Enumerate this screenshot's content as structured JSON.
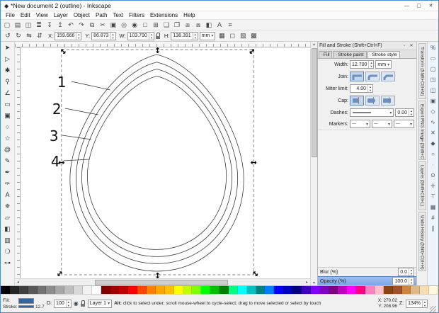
{
  "window": {
    "title": "*New document 2 (outline) - Inkscape",
    "icon": "◆",
    "controls": [
      {
        "name": "minimize-button",
        "glyph": "—"
      },
      {
        "name": "maximize-button",
        "glyph": "▢"
      },
      {
        "name": "close-button",
        "glyph": "✕"
      }
    ]
  },
  "menu": {
    "items": [
      "File",
      "Edit",
      "View",
      "Layer",
      "Object",
      "Path",
      "Text",
      "Filters",
      "Extensions",
      "Help"
    ]
  },
  "command_toolbar": {
    "items": [
      {
        "name": "new-document-icon",
        "glyph": "▢"
      },
      {
        "name": "open-document-icon",
        "glyph": "▤"
      },
      {
        "name": "save-document-icon",
        "glyph": "◫"
      },
      {
        "name": "print-icon",
        "glyph": "≣"
      },
      {
        "name": "import-icon",
        "glyph": "↧"
      },
      {
        "name": "export-icon",
        "glyph": "↥"
      },
      {
        "name": "undo-icon",
        "glyph": "↶"
      },
      {
        "name": "redo-icon",
        "glyph": "↷"
      },
      {
        "name": "copy-icon",
        "glyph": "⧉"
      },
      {
        "name": "cut-icon",
        "glyph": "✂"
      },
      {
        "name": "paste-icon",
        "glyph": "▣"
      },
      {
        "name": "zoom-selection-icon",
        "glyph": "◎"
      },
      {
        "name": "zoom-drawing-icon",
        "glyph": "◉"
      },
      {
        "name": "zoom-page-icon",
        "glyph": "□"
      },
      {
        "name": "duplicate-icon",
        "glyph": "⊞"
      },
      {
        "name": "clone-icon",
        "glyph": "❏"
      },
      {
        "name": "unlink-clone-icon",
        "glyph": "❐"
      },
      {
        "name": "group-icon",
        "glyph": "⧈"
      },
      {
        "name": "ungroup-icon",
        "glyph": "⧇"
      },
      {
        "name": "fill-stroke-dialog-icon",
        "glyph": "◧"
      },
      {
        "name": "text-dialog-icon",
        "glyph": "A"
      },
      {
        "name": "align-dialog-icon",
        "glyph": "≡"
      }
    ]
  },
  "tool_controls": {
    "buttons": [
      {
        "name": "rotate-90-ccw-button",
        "glyph": "↺"
      },
      {
        "name": "rotate-90-cw-button",
        "glyph": "↻"
      },
      {
        "name": "flip-horizontal-button",
        "glyph": "⇋"
      },
      {
        "name": "flip-vertical-button",
        "glyph": "⇵"
      }
    ],
    "x": {
      "label": "X:",
      "value": "159.666"
    },
    "y": {
      "label": "Y:",
      "value": "86.873"
    },
    "w": {
      "label": "W:",
      "value": "103.790"
    },
    "h": {
      "label": "H:",
      "value": "138.391"
    },
    "units": "mm",
    "affect_buttons": [
      {
        "name": "affect-stroke-toggle",
        "glyph": "▦"
      },
      {
        "name": "affect-corners-toggle",
        "glyph": "◻"
      },
      {
        "name": "affect-gradient-toggle",
        "glyph": "▨"
      },
      {
        "name": "affect-pattern-toggle",
        "glyph": "▩"
      }
    ]
  },
  "toolbox": {
    "tools": [
      {
        "name": "tool-selector",
        "glyph": "➤"
      },
      {
        "name": "tool-node-editor",
        "glyph": "▷"
      },
      {
        "name": "tool-tweak",
        "glyph": "✱"
      },
      {
        "name": "tool-zoom",
        "glyph": "⚲"
      },
      {
        "name": "tool-measure",
        "glyph": "∠"
      },
      {
        "name": "tool-rectangle",
        "glyph": "▭"
      },
      {
        "name": "tool-3dbox",
        "glyph": "▣"
      },
      {
        "name": "tool-ellipse",
        "glyph": "○"
      },
      {
        "name": "tool-star",
        "glyph": "☆"
      },
      {
        "name": "tool-spiral",
        "glyph": "@"
      },
      {
        "name": "tool-pencil",
        "glyph": "✎"
      },
      {
        "name": "tool-bezier-pen",
        "glyph": "✒"
      },
      {
        "name": "tool-calligraphy",
        "glyph": "✑"
      },
      {
        "name": "tool-text",
        "glyph": "A"
      },
      {
        "name": "tool-spray",
        "glyph": "✵"
      },
      {
        "name": "tool-eraser",
        "glyph": "▱"
      },
      {
        "name": "tool-bucket-fill",
        "glyph": "◧"
      },
      {
        "name": "tool-gradient",
        "glyph": "▥"
      },
      {
        "name": "tool-dropper",
        "glyph": "❍"
      },
      {
        "name": "tool-connector",
        "glyph": "⊶"
      }
    ]
  },
  "canvas": {
    "labels": [
      "1",
      "2",
      "3",
      "4"
    ],
    "icons": {
      "h_arrow": "↔",
      "v_arrow": "↕"
    }
  },
  "fill_stroke": {
    "title": "Fill and Stroke (Shift+Ctrl+F)",
    "buttons": [
      {
        "name": "dock-button",
        "glyph": "▫"
      },
      {
        "name": "close-button",
        "glyph": "✕"
      }
    ],
    "tabs": [
      {
        "name": "tab-fill",
        "label": "Fill"
      },
      {
        "name": "tab-stroke-paint",
        "label": "Stroke paint"
      },
      {
        "name": "tab-stroke-style",
        "label": "Stroke style"
      }
    ],
    "width": {
      "label": "Width:",
      "value": "12.700",
      "units": "mm"
    },
    "join": {
      "label": "Join:"
    },
    "miter": {
      "label": "Miter limit:",
      "value": "4.00"
    },
    "cap": {
      "label": "Cap:"
    },
    "dashes": {
      "label": "Dashes:",
      "offset": "0.00"
    },
    "markers": {
      "label": "Markers:"
    },
    "blur": {
      "label": "Blur (%)",
      "value": "0.0"
    },
    "opacity": {
      "label": "Opacity (%)",
      "value": "100.0"
    }
  },
  "dock_tabs": [
    {
      "name": "dock-tab-transform",
      "label": "Transform (Shift+Ctrl+M)"
    },
    {
      "name": "dock-tab-export-png",
      "label": "Export PNG Image (Shift+Ctrl+E)"
    },
    {
      "name": "dock-tab-layers",
      "label": "Layers (Shift+Ctrl+L)"
    },
    {
      "name": "dock-tab-undo-history",
      "label": "Undo History (Shift+Ctrl+H)"
    }
  ],
  "snap_toolbar": {
    "items": [
      {
        "name": "snap-enable-toggle",
        "glyph": "%"
      },
      {
        "name": "snap-bbox-toggle",
        "glyph": "▭"
      },
      {
        "name": "snap-bbox-edge-toggle",
        "glyph": "▢"
      },
      {
        "name": "snap-bbox-corner-toggle",
        "glyph": "◳"
      },
      {
        "name": "snap-bbox-edge-mid-toggle",
        "glyph": "◫"
      },
      {
        "name": "snap-bbox-center-toggle",
        "glyph": "▣"
      },
      {
        "name": "snap-nodes-toggle",
        "glyph": "◇"
      },
      {
        "name": "snap-path-toggle",
        "glyph": "∿"
      },
      {
        "name": "snap-intersection-toggle",
        "glyph": "✕"
      },
      {
        "name": "snap-cusp-node-toggle",
        "glyph": "◆"
      },
      {
        "name": "snap-smooth-node-toggle",
        "glyph": "○"
      },
      {
        "name": "snap-midpoint-toggle",
        "glyph": "∙"
      },
      {
        "name": "snap-object-center-toggle",
        "glyph": "⊙"
      },
      {
        "name": "snap-rotation-center-toggle",
        "glyph": "✛"
      },
      {
        "name": "snap-text-baseline-toggle",
        "glyph": "⊤"
      },
      {
        "name": "snap-page-border-toggle",
        "glyph": "▦"
      },
      {
        "name": "snap-grid-toggle",
        "glyph": "#"
      },
      {
        "name": "snap-guide-toggle",
        "glyph": "∥"
      }
    ]
  },
  "palette": {
    "colors": [
      "#000000",
      "#262626",
      "#404040",
      "#595959",
      "#737373",
      "#8c8c8c",
      "#a6a6a6",
      "#bfbfbf",
      "#d9d9d9",
      "#f2f2f2",
      "#ffffff",
      "#800000",
      "#a00000",
      "#c00000",
      "#ff0000",
      "#ff4500",
      "#ff7f00",
      "#ffa500",
      "#ffc000",
      "#ffff00",
      "#bfff00",
      "#80ff00",
      "#00ff00",
      "#00c000",
      "#008000",
      "#00ff80",
      "#00ffff",
      "#00c0c0",
      "#008080",
      "#0080ff",
      "#0000ff",
      "#0000c0",
      "#000080",
      "#4000c0",
      "#8000ff",
      "#8000c0",
      "#800080",
      "#c000c0",
      "#ff00ff",
      "#ff0080",
      "#ff80c0",
      "#ffc0cb",
      "#8b4513",
      "#a0522d",
      "#cd853f",
      "#deb887",
      "#f5deb3",
      "#fff8dc"
    ]
  },
  "statusbar": {
    "fill": {
      "label": "Fill:",
      "color": "#3465a4"
    },
    "stroke": {
      "label": "Stroke:",
      "color": "#3465a4",
      "width": "12.7"
    },
    "opacity": {
      "label": "O:",
      "value": "100"
    },
    "layer": {
      "eye_icon": "◉",
      "name": "Layer 1"
    },
    "message": {
      "prefix": "Alt:",
      "text": " click to select under; scroll mouse-wheel to cycle-select; drag to move selected or select by touch"
    },
    "coords": {
      "x_label": "X:",
      "x": "270.02",
      "y_label": "Y:",
      "y": "208.96"
    },
    "zoom": {
      "label": "Z:",
      "value": "134%"
    }
  }
}
